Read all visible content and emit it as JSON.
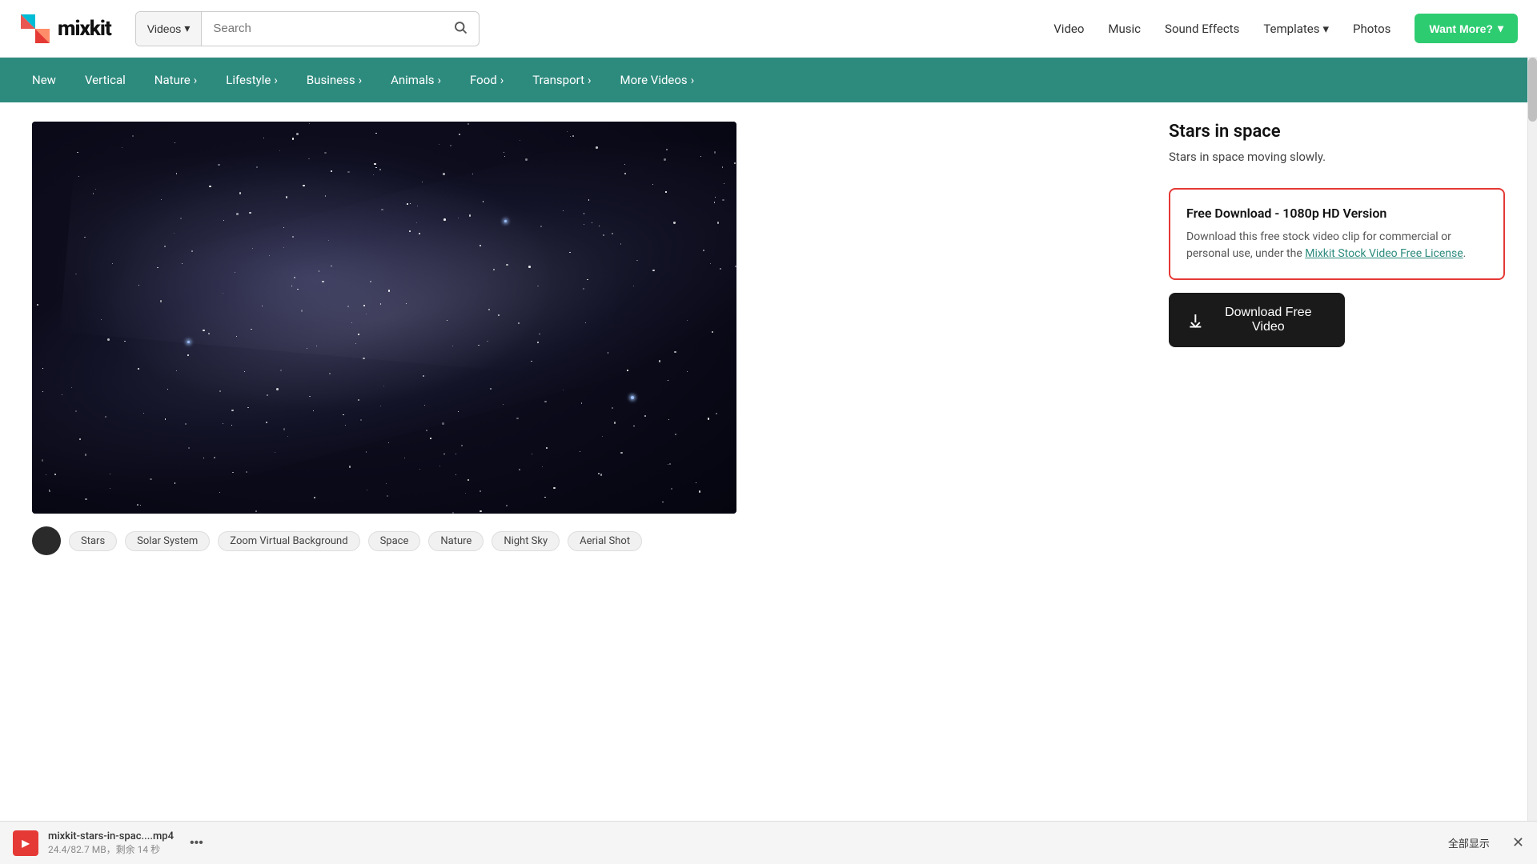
{
  "logo": {
    "text": "mixkit"
  },
  "header": {
    "search_type": "Videos",
    "search_placeholder": "Search",
    "nav": {
      "video": "Video",
      "music": "Music",
      "sound_effects": "Sound Effects",
      "templates": "Templates",
      "photos": "Photos"
    },
    "want_more": "Want More?"
  },
  "categories": [
    {
      "label": "New",
      "has_arrow": false
    },
    {
      "label": "Vertical",
      "has_arrow": false
    },
    {
      "label": "Nature",
      "has_arrow": true
    },
    {
      "label": "Lifestyle",
      "has_arrow": true
    },
    {
      "label": "Business",
      "has_arrow": true
    },
    {
      "label": "Animals",
      "has_arrow": true
    },
    {
      "label": "Food",
      "has_arrow": true
    },
    {
      "label": "Transport",
      "has_arrow": true
    },
    {
      "label": "More Videos",
      "has_arrow": true
    }
  ],
  "video": {
    "title": "Stars in space",
    "description": "Stars in space moving slowly.",
    "tags": [
      "Stars",
      "Solar System",
      "Zoom Virtual Background",
      "Space",
      "Nature",
      "Night Sky",
      "Aerial Shot"
    ]
  },
  "download_card": {
    "title": "Free Download - 1080p HD Version",
    "desc_before_link": "Download this free stock video clip for commercial or personal use, under the ",
    "link_text": "Mixkit Stock Video Free License",
    "desc_after_link": ".",
    "button_label": "Download Free Video"
  },
  "bottom_bar": {
    "file_name": "mixkit-stars-in-spac....mp4",
    "file_size": "24.4/82.7 MB，剩余 14 秒",
    "show_all": "全部显示"
  }
}
